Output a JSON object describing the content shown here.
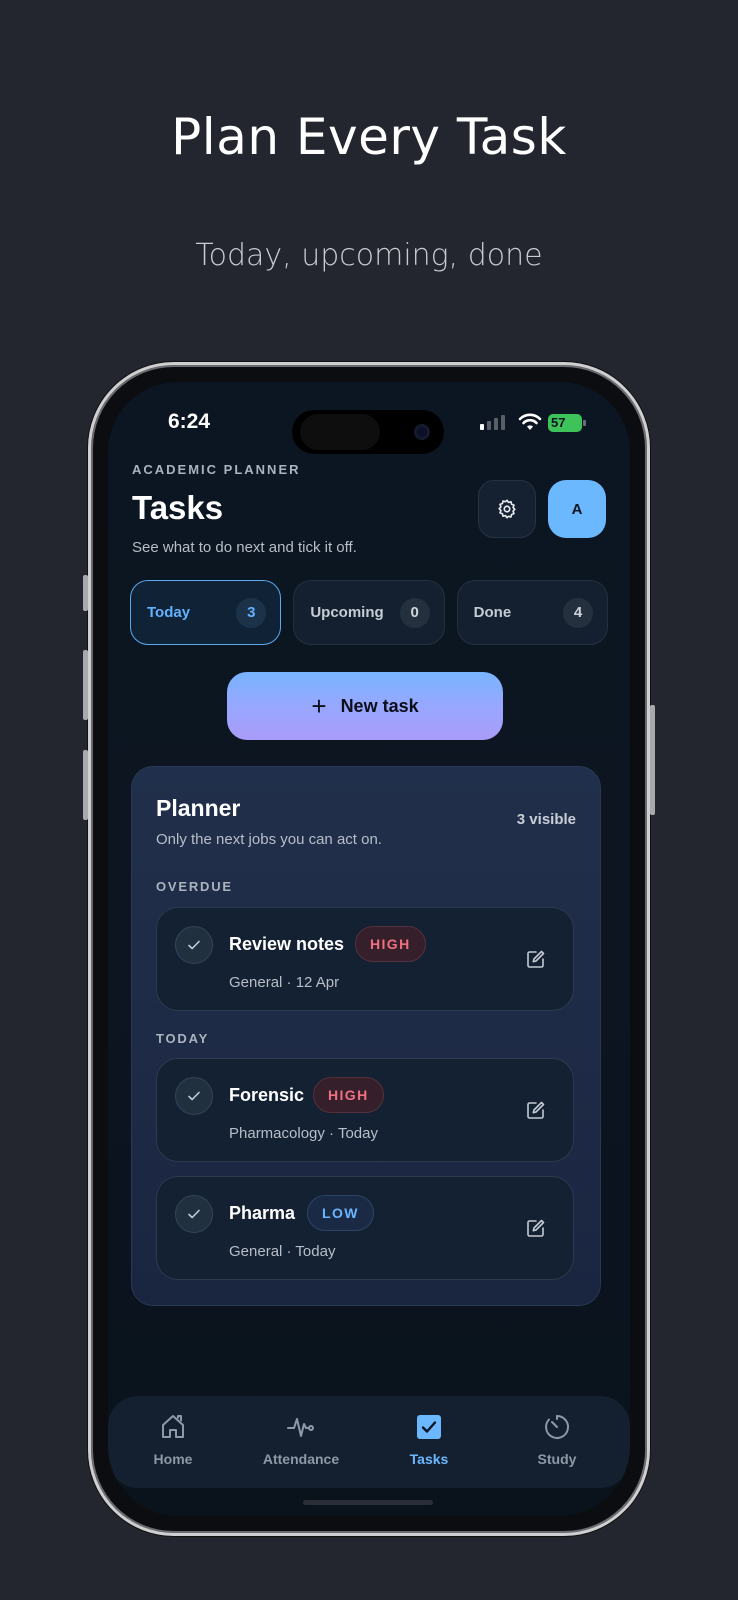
{
  "hero": {
    "title": "Plan Every Task",
    "subtitle": "Today, upcoming, done"
  },
  "status_bar": {
    "time": "6:24",
    "battery": "57"
  },
  "header": {
    "overline": "ACADEMIC PLANNER",
    "title": "Tasks",
    "subtitle": "See what to do next and tick it off.",
    "avatar_initial": "A"
  },
  "filters": [
    {
      "label": "Today",
      "count": "3",
      "active": true
    },
    {
      "label": "Upcoming",
      "count": "0",
      "active": false
    },
    {
      "label": "Done",
      "count": "4",
      "active": false
    }
  ],
  "new_task_label": "New task",
  "planner": {
    "title": "Planner",
    "description": "Only the next jobs you can act on.",
    "count": "3 visible",
    "sections": [
      {
        "label": "OVERDUE"
      },
      {
        "label": "TODAY"
      }
    ],
    "tasks": [
      {
        "name": "Review notes",
        "priority": "HIGH",
        "meta": "General · 12 Apr"
      },
      {
        "name": "Forensic",
        "priority": "HIGH",
        "meta": "Pharmacology · Today"
      },
      {
        "name": "Pharma",
        "priority": "LOW",
        "meta": "General · Today"
      }
    ]
  },
  "tabs": [
    {
      "label": "Home",
      "icon": "home-icon"
    },
    {
      "label": "Attendance",
      "icon": "pulse-icon"
    },
    {
      "label": "Tasks",
      "icon": "checkbox-icon",
      "active": true
    },
    {
      "label": "Study",
      "icon": "timer-icon"
    }
  ],
  "colors": {
    "accent": "#6cb8ff",
    "high": "#f07080",
    "low": "#6cb4ff",
    "background": "#23262e"
  }
}
